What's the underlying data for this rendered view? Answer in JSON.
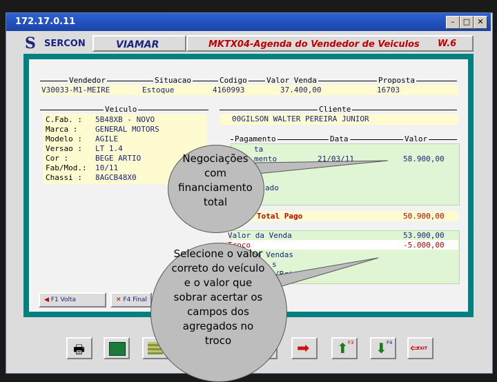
{
  "window": {
    "title": "172.17.0.11",
    "minimize": "–",
    "maximize": "□",
    "close": "✕"
  },
  "header": {
    "logo_letter": "S",
    "logo": "SERCON",
    "company": "VIAMAR",
    "screen": "MKTX04-Agenda do Vendedor de Veiculos",
    "version": "W.6"
  },
  "top_row": {
    "labels": [
      "Vendedor",
      "Situacao",
      "Codigo",
      "Valor Venda",
      "Proposta"
    ],
    "values": [
      "V30033-M1-MEIRE",
      "Estoque",
      "4160993",
      "37.400,00",
      "16703"
    ]
  },
  "vehicle": {
    "title": "Veiculo",
    "rows": [
      {
        "label": "C.Fab.  :",
        "value": "5B48XB - NOVO"
      },
      {
        "label": "Marca   :",
        "value": "GENERAL MOTORS"
      },
      {
        "label": "Modelo  :",
        "value": "AGILE"
      },
      {
        "label": "Versao  :",
        "value": "LT 1.4"
      },
      {
        "label": "Cor     :",
        "value": "BEGE ARTIO"
      },
      {
        "label": "Fab/Mod.:",
        "value": "10/11"
      },
      {
        "label": "Chassi  :",
        "value": "8AGCB48X0"
      }
    ]
  },
  "client": {
    "title": "Cliente",
    "value": "00GILSON WALTER PEREIRA JUNIOR"
  },
  "payment": {
    "headers": [
      "Pagamento",
      "Data",
      "Valor"
    ],
    "rows": [
      {
        "name": "ta",
        "date": "",
        "value": ""
      },
      {
        "name": "mento",
        "date": "21/03/11",
        "value": "58.900,00"
      },
      {
        "name": "",
        "date": "",
        "value": ""
      },
      {
        "name": "ado",
        "date": "",
        "value": ""
      },
      {
        "name": "",
        "date": "",
        "value": ""
      }
    ]
  },
  "totals": {
    "total_label": "Total Pago",
    "total_value": "50.900,00",
    "sale_label": "Valor da Venda",
    "sale_value": "53.900,00",
    "change_label": "Troco",
    "change_value": "-5.000,00",
    "extra1": "s Vendas",
    "extra2": "s",
    "extra3": "/Brindes"
  },
  "buttons": {
    "f1": "F1 Volta",
    "f4": "F4 Final"
  },
  "callouts": {
    "top": "Negociações com financiamento total",
    "bottom": "Selecione o valor correto do veículo e o valor que sobrar acertar os campos dos agregados  no troco"
  },
  "toolbar": {
    "f3": "F3",
    "f4": "F4",
    "exit": "EXIT"
  },
  "colors": {
    "panel": "#008080",
    "titlebar": "#2d62d6",
    "accent": "#c00000"
  }
}
